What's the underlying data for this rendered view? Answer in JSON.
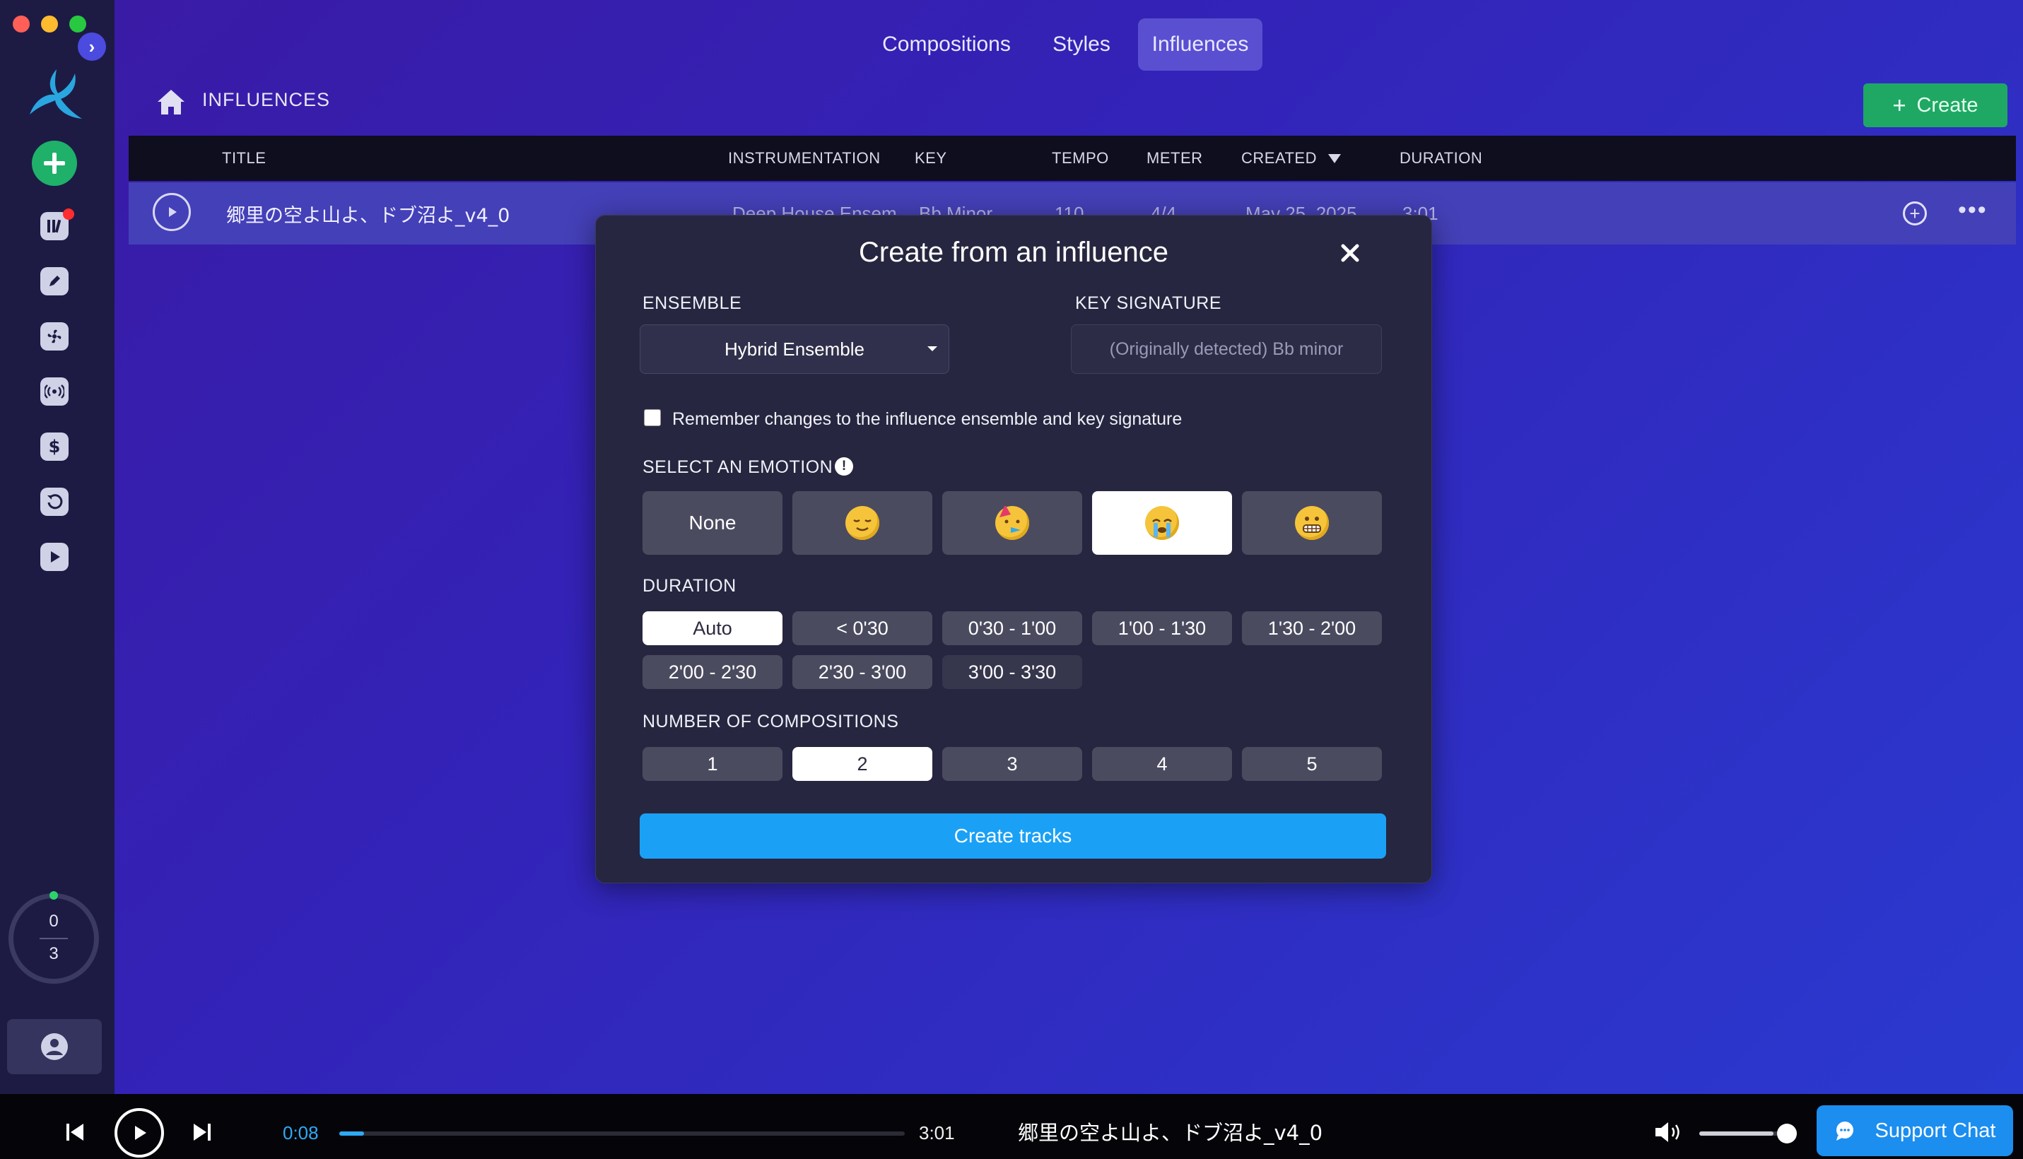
{
  "nav": {
    "tabs": [
      {
        "label": "Compositions"
      },
      {
        "label": "Styles"
      },
      {
        "label": "Influences",
        "active": true
      }
    ]
  },
  "breadcrumb": {
    "title": "INFLUENCES"
  },
  "toolbar": {
    "create_label": "Create"
  },
  "sidebar": {
    "icons": [
      "add-icon",
      "library-icon",
      "pencil-icon",
      "fan-icon",
      "broadcast-icon",
      "dollar-icon",
      "history-icon",
      "play-icon",
      "profile-icon"
    ],
    "credits": {
      "used": "0",
      "total": "3"
    }
  },
  "table": {
    "columns": [
      "TITLE",
      "INSTRUMENTATION",
      "KEY",
      "TEMPO",
      "METER",
      "CREATED",
      "DURATION"
    ],
    "rows": [
      {
        "title": "郷里の空よ山よ、ドブ沼よ_v4_0",
        "instrumentation": "Deep House Ensem",
        "key": "Bb Minor",
        "tempo": "110",
        "meter": "4/4",
        "created": "May 25, 2025",
        "duration": "3:01"
      }
    ]
  },
  "modal": {
    "title": "Create from an influence",
    "ensemble_label": "ENSEMBLE",
    "ensemble_value": "Hybrid Ensemble",
    "key_label": "KEY SIGNATURE",
    "key_placeholder": "(Originally detected) Bb minor",
    "remember_label": "Remember changes to the influence ensemble and key signature",
    "emotion_label": "SELECT AN EMOTION",
    "emotion_info": "!",
    "emotions": [
      {
        "label": "None",
        "icon": "none"
      },
      {
        "label": "",
        "icon": "relieved-face-icon"
      },
      {
        "label": "",
        "icon": "party-face-icon"
      },
      {
        "label": "",
        "icon": "crying-face-icon",
        "selected": true
      },
      {
        "label": "",
        "icon": "grimacing-face-icon"
      }
    ],
    "duration_label": "DURATION",
    "durations": [
      "Auto",
      "< 0'30",
      "0'30 - 1'00",
      "1'00 - 1'30",
      "1'30 - 2'00",
      "2'00 - 2'30",
      "2'30 - 3'00",
      "3'00 - 3'30"
    ],
    "duration_selected": "Auto",
    "count_label": "NUMBER OF COMPOSITIONS",
    "counts": [
      "1",
      "2",
      "3",
      "4",
      "5"
    ],
    "count_selected": "2",
    "submit_label": "Create tracks"
  },
  "player": {
    "elapsed": "0:08",
    "duration": "3:01",
    "progress": 0.044,
    "now_playing": "郷里の空よ山よ、ドブ沼よ_v4_0",
    "volume": 0.85
  },
  "support": {
    "label": "Support Chat"
  },
  "colors": {
    "accent": "#1aa1f5",
    "create_green": "#1fa863",
    "active_tab": "#5a4fd1",
    "row_bg": "#4440b8"
  }
}
